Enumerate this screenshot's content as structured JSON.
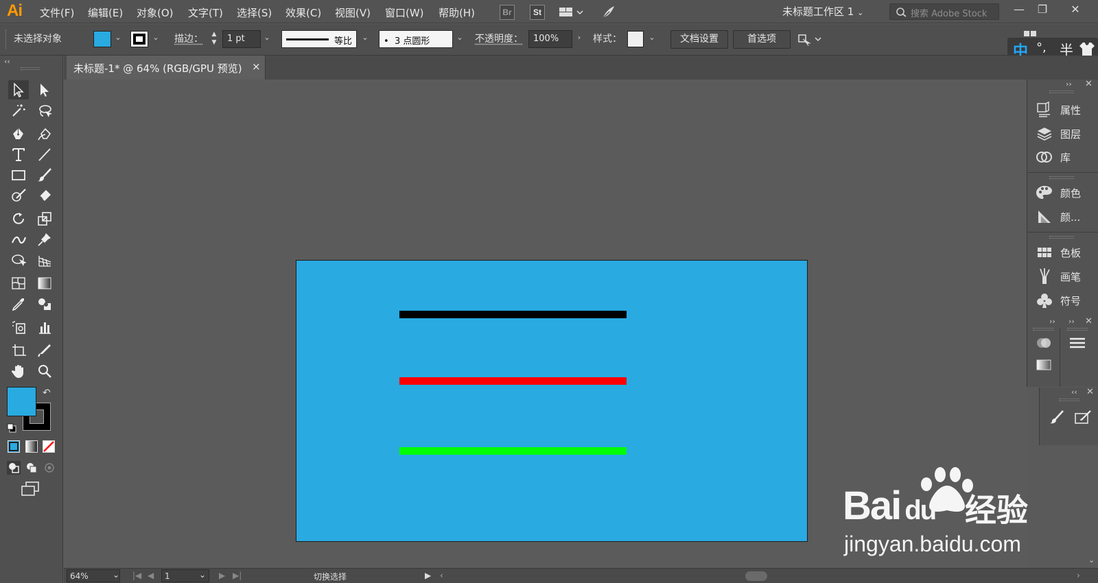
{
  "app": {
    "logo": "Ai",
    "workspace": "未标题工作区 1"
  },
  "menubar": {
    "items": [
      "文件(F)",
      "编辑(E)",
      "对象(O)",
      "文字(T)",
      "选择(S)",
      "效果(C)",
      "视图(V)",
      "窗口(W)",
      "帮助(H)"
    ]
  },
  "bridge": {
    "br": "Br",
    "st": "St"
  },
  "search": {
    "placeholder": "搜索 Adobe Stock"
  },
  "window": {
    "minimize": "—",
    "restore": "❐",
    "close": "✕"
  },
  "control": {
    "no_selection": "未选择对象",
    "stroke_label": "描边：",
    "stroke_value": "1 pt",
    "profile_label": "等比",
    "brush_label": "3 点圆形",
    "brush_dot": "•",
    "opacity_label": "不透明度：",
    "opacity_value": "100%",
    "style_label": "样式：",
    "doc_setup": "文档设置",
    "preferences": "首选项",
    "fill_color": "#29aae1",
    "stroke_color": "#000000"
  },
  "ime": {
    "zh": "中",
    "punct": "°,",
    "half": "半"
  },
  "document": {
    "tab_title": "未标题-1* @ 64% (RGB/GPU 预览)",
    "tab_close": "×"
  },
  "artboard": {
    "background": "#29aae1",
    "lines": [
      {
        "color": "#000000"
      },
      {
        "color": "#ff0000"
      },
      {
        "color": "#00ff00"
      }
    ]
  },
  "panels": {
    "group1": [
      {
        "label": "属性",
        "icon": "properties-icon"
      },
      {
        "label": "图层",
        "icon": "layers-icon"
      },
      {
        "label": "库",
        "icon": "libraries-icon"
      }
    ],
    "group2": [
      {
        "label": "颜色",
        "icon": "color-icon"
      },
      {
        "label": "颜...",
        "icon": "color-guide-icon"
      }
    ],
    "group3": [
      {
        "label": "色板",
        "icon": "swatches-icon"
      },
      {
        "label": "画笔",
        "icon": "brushes-icon"
      },
      {
        "label": "符号",
        "icon": "symbols-icon"
      }
    ]
  },
  "status": {
    "zoom": "64%",
    "page": "1",
    "hint": "切换选择"
  },
  "watermark": {
    "brand": "Bai",
    "brand2": "du",
    "cn": "经验",
    "url": "jingyan.baidu.com"
  }
}
